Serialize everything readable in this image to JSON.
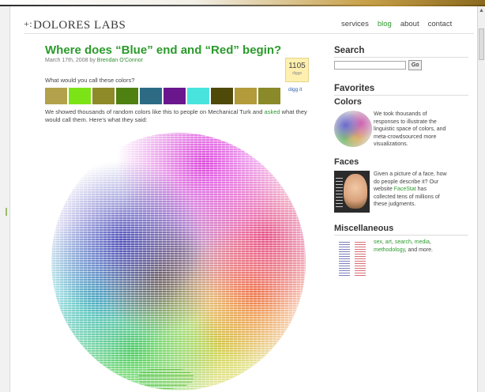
{
  "header": {
    "logo": "DOLORES LABS",
    "nav": [
      {
        "label": "services",
        "active": false
      },
      {
        "label": "blog",
        "active": true
      },
      {
        "label": "about",
        "active": false
      },
      {
        "label": "contact",
        "active": false
      }
    ]
  },
  "post": {
    "title": "Where does “Blue” end and “Red” begin?",
    "date": "March 17th, 2008 by",
    "author": "Brendan O'Connor",
    "digg_count": "1105",
    "digg_unit": "diggs",
    "digg_link": "digg it",
    "question": "What would you call these colors?",
    "swatches": [
      "#b3a14c",
      "#7ce316",
      "#8e8a28",
      "#4e8112",
      "#2d6b85",
      "#6a178e",
      "#49e3dd",
      "#4f4a0a",
      "#b39b3b",
      "#8a8a2a"
    ],
    "desc_before": "We showed thousands of random colors like this to people on Mechanical Turk and",
    "desc_link": "asked",
    "desc_after": "what they would call them. Here’s what they said:"
  },
  "sidebar": {
    "search_heading": "Search",
    "search_value": "",
    "search_button": "Go",
    "favorites_heading": "Favorites",
    "colors": {
      "heading": "Colors",
      "text": "We took thousands of responses to illustrate the linguistic space of colors, and meta-crowdsourced more visualizations."
    },
    "faces": {
      "heading": "Faces",
      "text_before": "Given a picture of a face, how do people describe it? Our website",
      "text_link": "FaceStat",
      "text_after": "has collected tens of millions of these judgments."
    },
    "misc": {
      "heading": "Miscellaneous",
      "links": [
        "sex",
        "art",
        "search",
        "media",
        "methodology"
      ],
      "text_after": ", and more."
    }
  }
}
